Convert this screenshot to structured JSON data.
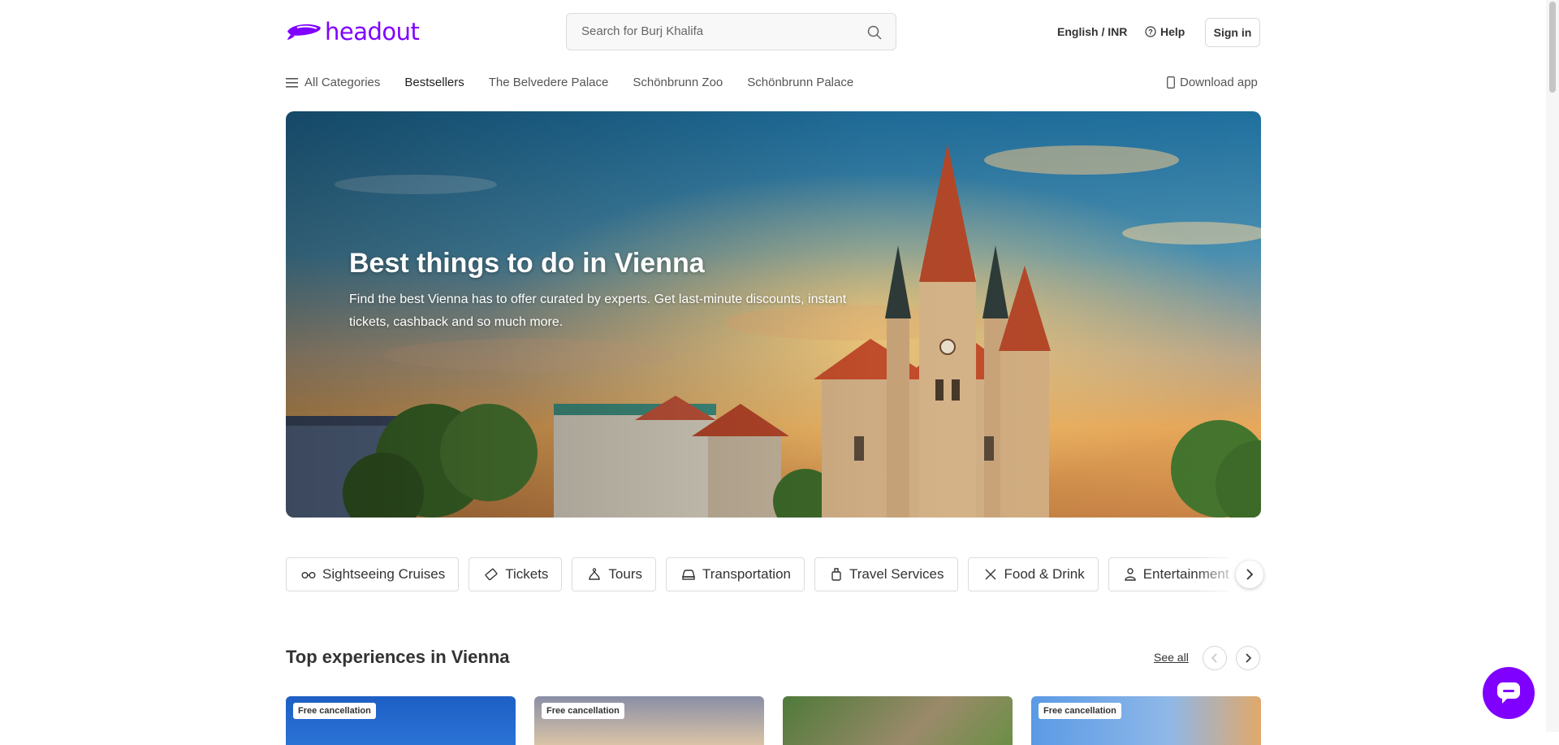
{
  "brand": {
    "name": "headout",
    "color": "#8000ff"
  },
  "header": {
    "search_placeholder": "Search for Burj Khalifa",
    "language_currency": "English / INR",
    "help_label": "Help",
    "signin_label": "Sign in"
  },
  "nav": {
    "all_categories": "All Categories",
    "items": [
      "Bestsellers",
      "The Belvedere Palace",
      "Schönbrunn Zoo",
      "Schönbrunn Palace"
    ],
    "download_app": "Download app"
  },
  "hero": {
    "title": "Best things to do in Vienna",
    "subtitle": "Find the best Vienna has to offer curated by experts. Get last-minute discounts, instant tickets, cashback and so much more."
  },
  "categories": [
    {
      "label": "Sightseeing Cruises",
      "icon": "cruise-icon"
    },
    {
      "label": "Tickets",
      "icon": "ticket-icon"
    },
    {
      "label": "Tours",
      "icon": "tours-icon"
    },
    {
      "label": "Transportation",
      "icon": "car-icon"
    },
    {
      "label": "Travel Services",
      "icon": "travel-services-icon"
    },
    {
      "label": "Food & Drink",
      "icon": "food-drink-icon"
    },
    {
      "label": "Entertainment",
      "icon": "entertainment-icon"
    }
  ],
  "top_experiences": {
    "title": "Top experiences in Vienna",
    "see_all": "See all",
    "cards": [
      {
        "badge": "Free cancellation"
      },
      {
        "badge": "Free cancellation"
      },
      {
        "badge": ""
      },
      {
        "badge": "Free cancellation"
      }
    ]
  }
}
